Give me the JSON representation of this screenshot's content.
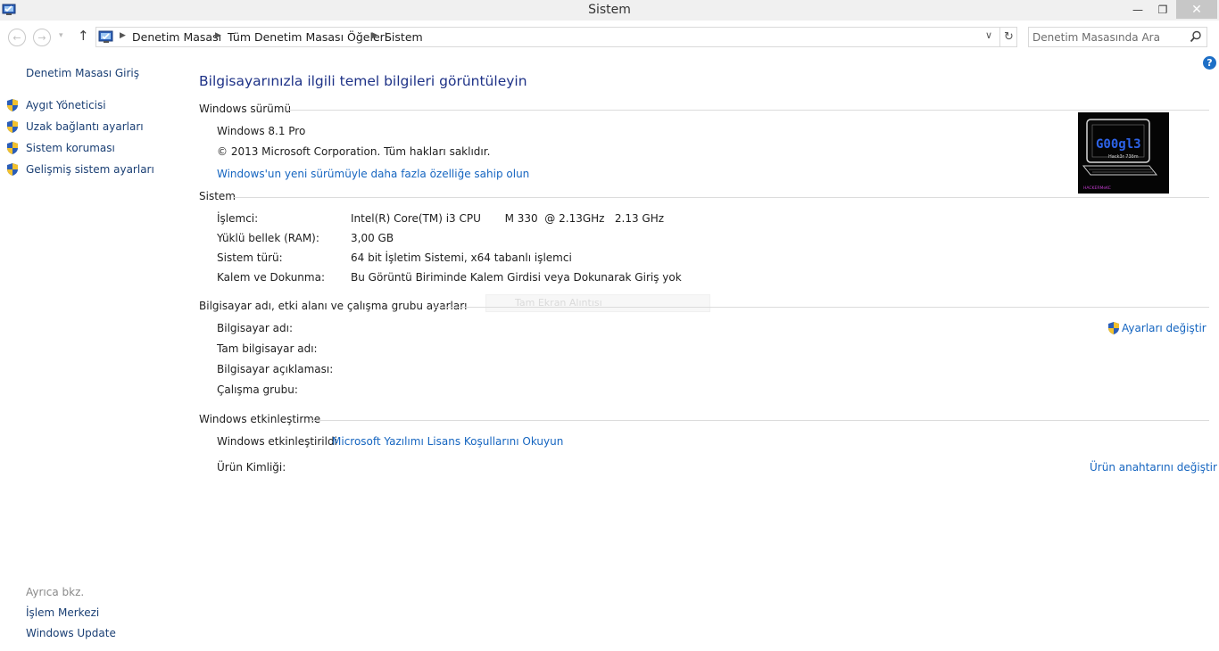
{
  "window": {
    "title": "Sistem",
    "minimize_glyph": "—",
    "maximize_glyph": "❐",
    "close_glyph": "✕"
  },
  "nav": {
    "back_glyph": "←",
    "forward_glyph": "→",
    "recent_glyph": "▾",
    "up_glyph": "↑",
    "breadcrumb": [
      "Denetim Masası",
      "Tüm Denetim Masası Öğeleri",
      "Sistem"
    ],
    "crumb_separator": "▶",
    "dropdown_glyph": "∨",
    "refresh_glyph": "↻",
    "search_placeholder": "Denetim Masasında Ara"
  },
  "sidebar": {
    "home": "Denetim Masası Giriş",
    "tasks": [
      {
        "label": "Aygıt Yöneticisi",
        "icon": "uac-shield-icon"
      },
      {
        "label": "Uzak bağlantı ayarları",
        "icon": "uac-shield-icon"
      },
      {
        "label": "Sistem koruması",
        "icon": "uac-shield-icon"
      },
      {
        "label": "Gelişmiş sistem ayarları",
        "icon": "uac-shield-icon"
      }
    ],
    "see_also_heading": "Ayrıca bkz.",
    "see_also": [
      "İşlem Merkezi",
      "Windows Update"
    ]
  },
  "help_glyph": "?",
  "main": {
    "title": "Bilgisayarınızla ilgili temel bilgileri görüntüleyin",
    "edition": {
      "heading": "Windows sürümü",
      "name": "Windows 8.1 Pro",
      "copyright": "© 2013 Microsoft Corporation. Tüm hakları saklıdır.",
      "upgrade_link": "Windows'un yeni sürümüyle daha fazla özelliğe sahip olun"
    },
    "logo": {
      "text": "G00gl3",
      "subtext": "Hack3r 73ðm",
      "footer": "HACKERMeKC"
    },
    "system": {
      "heading": "Sistem",
      "rows": [
        {
          "label": "İşlemci:",
          "value": "Intel(R) Core(TM) i3 CPU       M 330  @ 2.13GHz   2.13 GHz"
        },
        {
          "label": "Yüklü bellek (RAM):",
          "value": "3,00 GB"
        },
        {
          "label": "Sistem türü:",
          "value": "64 bit İşletim Sistemi, x64 tabanlı işlemci"
        },
        {
          "label": "Kalem ve Dokunma:",
          "value": "Bu Görüntü Biriminde Kalem Girdisi veya Dokunarak Giriş yok"
        }
      ]
    },
    "computer_name": {
      "heading": "Bilgisayar adı, etki alanı ve çalışma grubu ayarları",
      "rows": [
        {
          "label": "Bilgisayar adı:",
          "value": ""
        },
        {
          "label": "Tam bilgisayar adı:",
          "value": ""
        },
        {
          "label": "Bilgisayar açıklaması:",
          "value": ""
        },
        {
          "label": "Çalışma grubu:",
          "value": ""
        }
      ],
      "change_settings_link": "Ayarları değiştir"
    },
    "activation": {
      "heading": "Windows etkinleştirme",
      "status": "Windows etkinleştirildi",
      "license_link": "Microsoft Yazılımı Lisans Koşullarını Okuyun",
      "product_id_label": "Ürün Kimliği:",
      "change_key_link": "Ürün anahtarını değiştir"
    },
    "overlay_ghost_text": "Tam Ekran Alıntısı"
  },
  "colors": {
    "link": "#1565c0",
    "nav_link": "#1a3f74",
    "title": "#1e3287"
  }
}
